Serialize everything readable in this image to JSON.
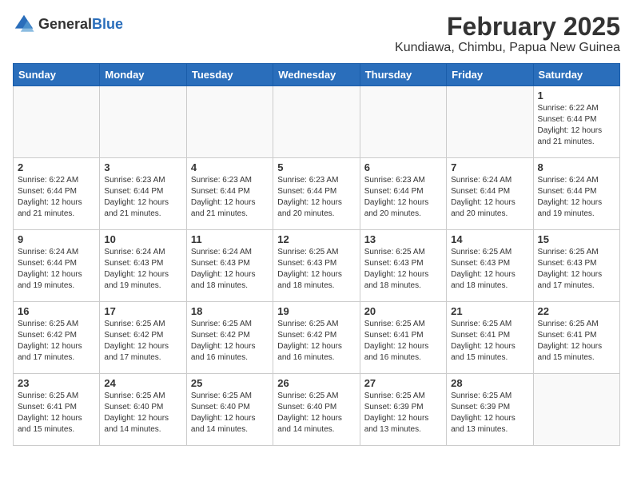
{
  "logo": {
    "general": "General",
    "blue": "Blue"
  },
  "title": "February 2025",
  "subtitle": "Kundiawa, Chimbu, Papua New Guinea",
  "days": [
    "Sunday",
    "Monday",
    "Tuesday",
    "Wednesday",
    "Thursday",
    "Friday",
    "Saturday"
  ],
  "weeks": [
    [
      {
        "day": "",
        "info": ""
      },
      {
        "day": "",
        "info": ""
      },
      {
        "day": "",
        "info": ""
      },
      {
        "day": "",
        "info": ""
      },
      {
        "day": "",
        "info": ""
      },
      {
        "day": "",
        "info": ""
      },
      {
        "day": "1",
        "info": "Sunrise: 6:22 AM\nSunset: 6:44 PM\nDaylight: 12 hours and 21 minutes."
      }
    ],
    [
      {
        "day": "2",
        "info": "Sunrise: 6:22 AM\nSunset: 6:44 PM\nDaylight: 12 hours and 21 minutes."
      },
      {
        "day": "3",
        "info": "Sunrise: 6:23 AM\nSunset: 6:44 PM\nDaylight: 12 hours and 21 minutes."
      },
      {
        "day": "4",
        "info": "Sunrise: 6:23 AM\nSunset: 6:44 PM\nDaylight: 12 hours and 21 minutes."
      },
      {
        "day": "5",
        "info": "Sunrise: 6:23 AM\nSunset: 6:44 PM\nDaylight: 12 hours and 20 minutes."
      },
      {
        "day": "6",
        "info": "Sunrise: 6:23 AM\nSunset: 6:44 PM\nDaylight: 12 hours and 20 minutes."
      },
      {
        "day": "7",
        "info": "Sunrise: 6:24 AM\nSunset: 6:44 PM\nDaylight: 12 hours and 20 minutes."
      },
      {
        "day": "8",
        "info": "Sunrise: 6:24 AM\nSunset: 6:44 PM\nDaylight: 12 hours and 19 minutes."
      }
    ],
    [
      {
        "day": "9",
        "info": "Sunrise: 6:24 AM\nSunset: 6:44 PM\nDaylight: 12 hours and 19 minutes."
      },
      {
        "day": "10",
        "info": "Sunrise: 6:24 AM\nSunset: 6:43 PM\nDaylight: 12 hours and 19 minutes."
      },
      {
        "day": "11",
        "info": "Sunrise: 6:24 AM\nSunset: 6:43 PM\nDaylight: 12 hours and 18 minutes."
      },
      {
        "day": "12",
        "info": "Sunrise: 6:25 AM\nSunset: 6:43 PM\nDaylight: 12 hours and 18 minutes."
      },
      {
        "day": "13",
        "info": "Sunrise: 6:25 AM\nSunset: 6:43 PM\nDaylight: 12 hours and 18 minutes."
      },
      {
        "day": "14",
        "info": "Sunrise: 6:25 AM\nSunset: 6:43 PM\nDaylight: 12 hours and 18 minutes."
      },
      {
        "day": "15",
        "info": "Sunrise: 6:25 AM\nSunset: 6:43 PM\nDaylight: 12 hours and 17 minutes."
      }
    ],
    [
      {
        "day": "16",
        "info": "Sunrise: 6:25 AM\nSunset: 6:42 PM\nDaylight: 12 hours and 17 minutes."
      },
      {
        "day": "17",
        "info": "Sunrise: 6:25 AM\nSunset: 6:42 PM\nDaylight: 12 hours and 17 minutes."
      },
      {
        "day": "18",
        "info": "Sunrise: 6:25 AM\nSunset: 6:42 PM\nDaylight: 12 hours and 16 minutes."
      },
      {
        "day": "19",
        "info": "Sunrise: 6:25 AM\nSunset: 6:42 PM\nDaylight: 12 hours and 16 minutes."
      },
      {
        "day": "20",
        "info": "Sunrise: 6:25 AM\nSunset: 6:41 PM\nDaylight: 12 hours and 16 minutes."
      },
      {
        "day": "21",
        "info": "Sunrise: 6:25 AM\nSunset: 6:41 PM\nDaylight: 12 hours and 15 minutes."
      },
      {
        "day": "22",
        "info": "Sunrise: 6:25 AM\nSunset: 6:41 PM\nDaylight: 12 hours and 15 minutes."
      }
    ],
    [
      {
        "day": "23",
        "info": "Sunrise: 6:25 AM\nSunset: 6:41 PM\nDaylight: 12 hours and 15 minutes."
      },
      {
        "day": "24",
        "info": "Sunrise: 6:25 AM\nSunset: 6:40 PM\nDaylight: 12 hours and 14 minutes."
      },
      {
        "day": "25",
        "info": "Sunrise: 6:25 AM\nSunset: 6:40 PM\nDaylight: 12 hours and 14 minutes."
      },
      {
        "day": "26",
        "info": "Sunrise: 6:25 AM\nSunset: 6:40 PM\nDaylight: 12 hours and 14 minutes."
      },
      {
        "day": "27",
        "info": "Sunrise: 6:25 AM\nSunset: 6:39 PM\nDaylight: 12 hours and 13 minutes."
      },
      {
        "day": "28",
        "info": "Sunrise: 6:25 AM\nSunset: 6:39 PM\nDaylight: 12 hours and 13 minutes."
      },
      {
        "day": "",
        "info": ""
      }
    ]
  ]
}
